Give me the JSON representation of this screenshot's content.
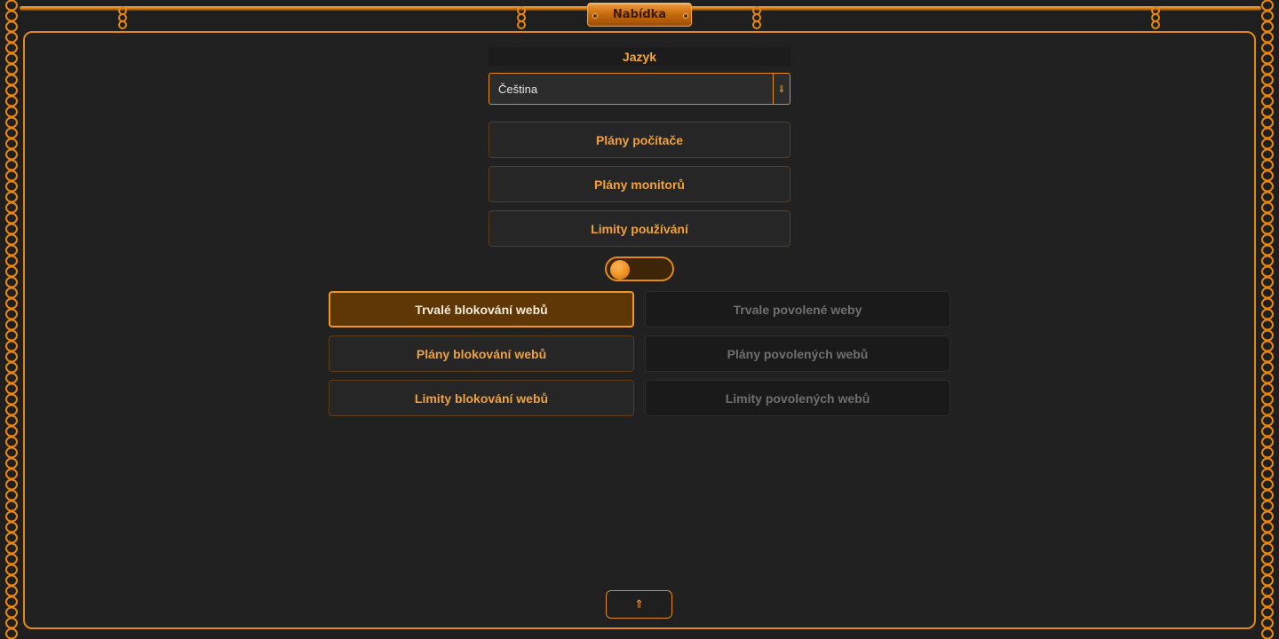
{
  "header": {
    "title": "Nabídka"
  },
  "language": {
    "label": "Jazyk",
    "selected": "Čeština",
    "dropdown_icon": "chevron-down-icon"
  },
  "plans": {
    "computer": "Plány počítače",
    "monitors": "Plány monitorů",
    "usage_limits": "Limity používání"
  },
  "toggle": {
    "state": "off"
  },
  "web_block": {
    "permanent": "Trvalé blokování webů",
    "schedules": "Plány blokování webů",
    "limits": "Limity blokování webů"
  },
  "web_allow": {
    "permanent": "Trvale povolené weby",
    "schedules": "Plány povolených webů",
    "limits": "Limity povolených webů"
  },
  "footer": {
    "scroll_top_icon": "arrow-up-icon"
  },
  "colors": {
    "accent": "#e18a16",
    "active_bg": "#5e3705",
    "disabled_text": "#6f6f6f"
  }
}
